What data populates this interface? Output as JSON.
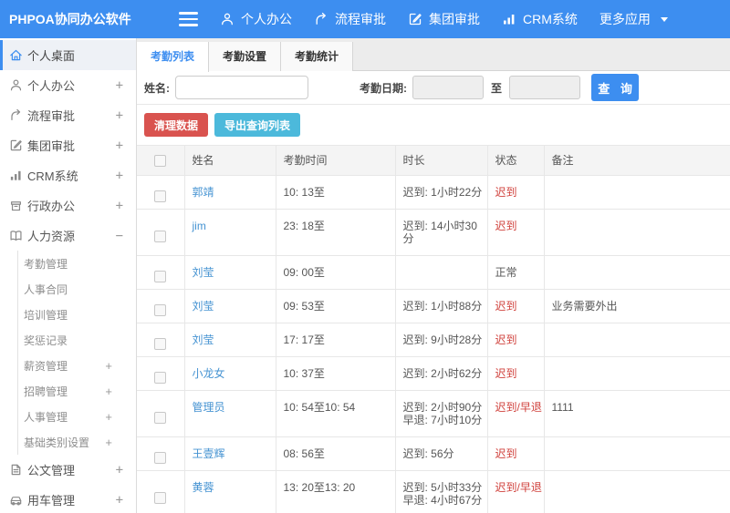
{
  "colors": {
    "blue": "#3d8ef0",
    "link": "#4593d2",
    "red": "#d9534f",
    "red2": "#d0413c",
    "teal": "#4cb9db"
  },
  "header": {
    "brand": "PHPOA协同办公软件",
    "nav": [
      {
        "icon": "user",
        "label": "个人办公"
      },
      {
        "icon": "flow",
        "label": "流程审批"
      },
      {
        "icon": "edit",
        "label": "集团审批"
      },
      {
        "icon": "chart",
        "label": "CRM系统"
      },
      {
        "icon": "",
        "label": "更多应用",
        "caret": true
      }
    ]
  },
  "sidebar": {
    "items": [
      {
        "icon": "home",
        "label": "个人桌面",
        "active": true
      },
      {
        "icon": "user",
        "label": "个人办公",
        "pm": "+"
      },
      {
        "icon": "flow",
        "label": "流程审批",
        "pm": "+"
      },
      {
        "icon": "edit",
        "label": "集团审批",
        "pm": "+"
      },
      {
        "icon": "chart",
        "label": "CRM系统",
        "pm": "+"
      },
      {
        "icon": "box",
        "label": "行政办公",
        "pm": "+"
      },
      {
        "icon": "book",
        "label": "人力资源",
        "pm": "−",
        "children": [
          {
            "label": "考勤管理"
          },
          {
            "label": "人事合同"
          },
          {
            "label": "培训管理"
          },
          {
            "label": "奖惩记录"
          },
          {
            "label": "薪资管理",
            "pm": "+"
          },
          {
            "label": "招聘管理",
            "pm": "+"
          },
          {
            "label": "人事管理",
            "pm": "+"
          },
          {
            "label": "基础类别设置",
            "pm": "+"
          }
        ]
      },
      {
        "icon": "doc",
        "label": "公文管理",
        "pm": "+"
      },
      {
        "icon": "car",
        "label": "用车管理",
        "pm": "+"
      }
    ]
  },
  "tabs": [
    {
      "label": "考勤列表",
      "active": true
    },
    {
      "label": "考勤设置"
    },
    {
      "label": "考勤统计"
    }
  ],
  "filter": {
    "name_label": "姓名:",
    "date_label": "考勤日期:",
    "to_label": "至",
    "search_label": "查 询"
  },
  "actions": {
    "clean": "清理数据",
    "export": "导出查询列表"
  },
  "table": {
    "headers": [
      "姓名",
      "考勤时间",
      "时长",
      "状态",
      "备注"
    ],
    "rows": [
      {
        "name": "郭靖",
        "time": "10: 13至",
        "duration": [
          "迟到: 1小时22分"
        ],
        "status": "迟到",
        "kind": "red",
        "remark": ""
      },
      {
        "name": "jim",
        "time": "23: 18至",
        "duration": [
          "迟到: 14小时30分"
        ],
        "status": "迟到",
        "kind": "red",
        "remark": ""
      },
      {
        "name": "刘莹",
        "time": "09: 00至",
        "duration": [],
        "status": "正常",
        "kind": "normal",
        "remark": ""
      },
      {
        "name": "刘莹",
        "time": "09: 53至",
        "duration": [
          "迟到: 1小时88分"
        ],
        "status": "迟到",
        "kind": "red",
        "remark": "业务需要外出"
      },
      {
        "name": "刘莹",
        "time": "17: 17至",
        "duration": [
          "迟到: 9小时28分"
        ],
        "status": "迟到",
        "kind": "red",
        "remark": ""
      },
      {
        "name": "小龙女",
        "time": "10: 37至",
        "duration": [
          "迟到: 2小时62分"
        ],
        "status": "迟到",
        "kind": "red",
        "remark": ""
      },
      {
        "name": "管理员",
        "time": "10: 54至10: 54",
        "duration": [
          "迟到: 2小时90分",
          "早退: 7小时10分"
        ],
        "status": "迟到/早退",
        "kind": "red",
        "remark": "1111"
      },
      {
        "name": "王壹辉",
        "time": "08: 56至",
        "duration": [
          "迟到: 56分"
        ],
        "status": "迟到",
        "kind": "red",
        "remark": ""
      },
      {
        "name": "黄蓉",
        "time": "13: 20至13: 20",
        "duration": [
          "迟到: 5小时33分",
          "早退: 4小时67分"
        ],
        "status": "迟到/早退",
        "kind": "red",
        "remark": ""
      }
    ]
  }
}
